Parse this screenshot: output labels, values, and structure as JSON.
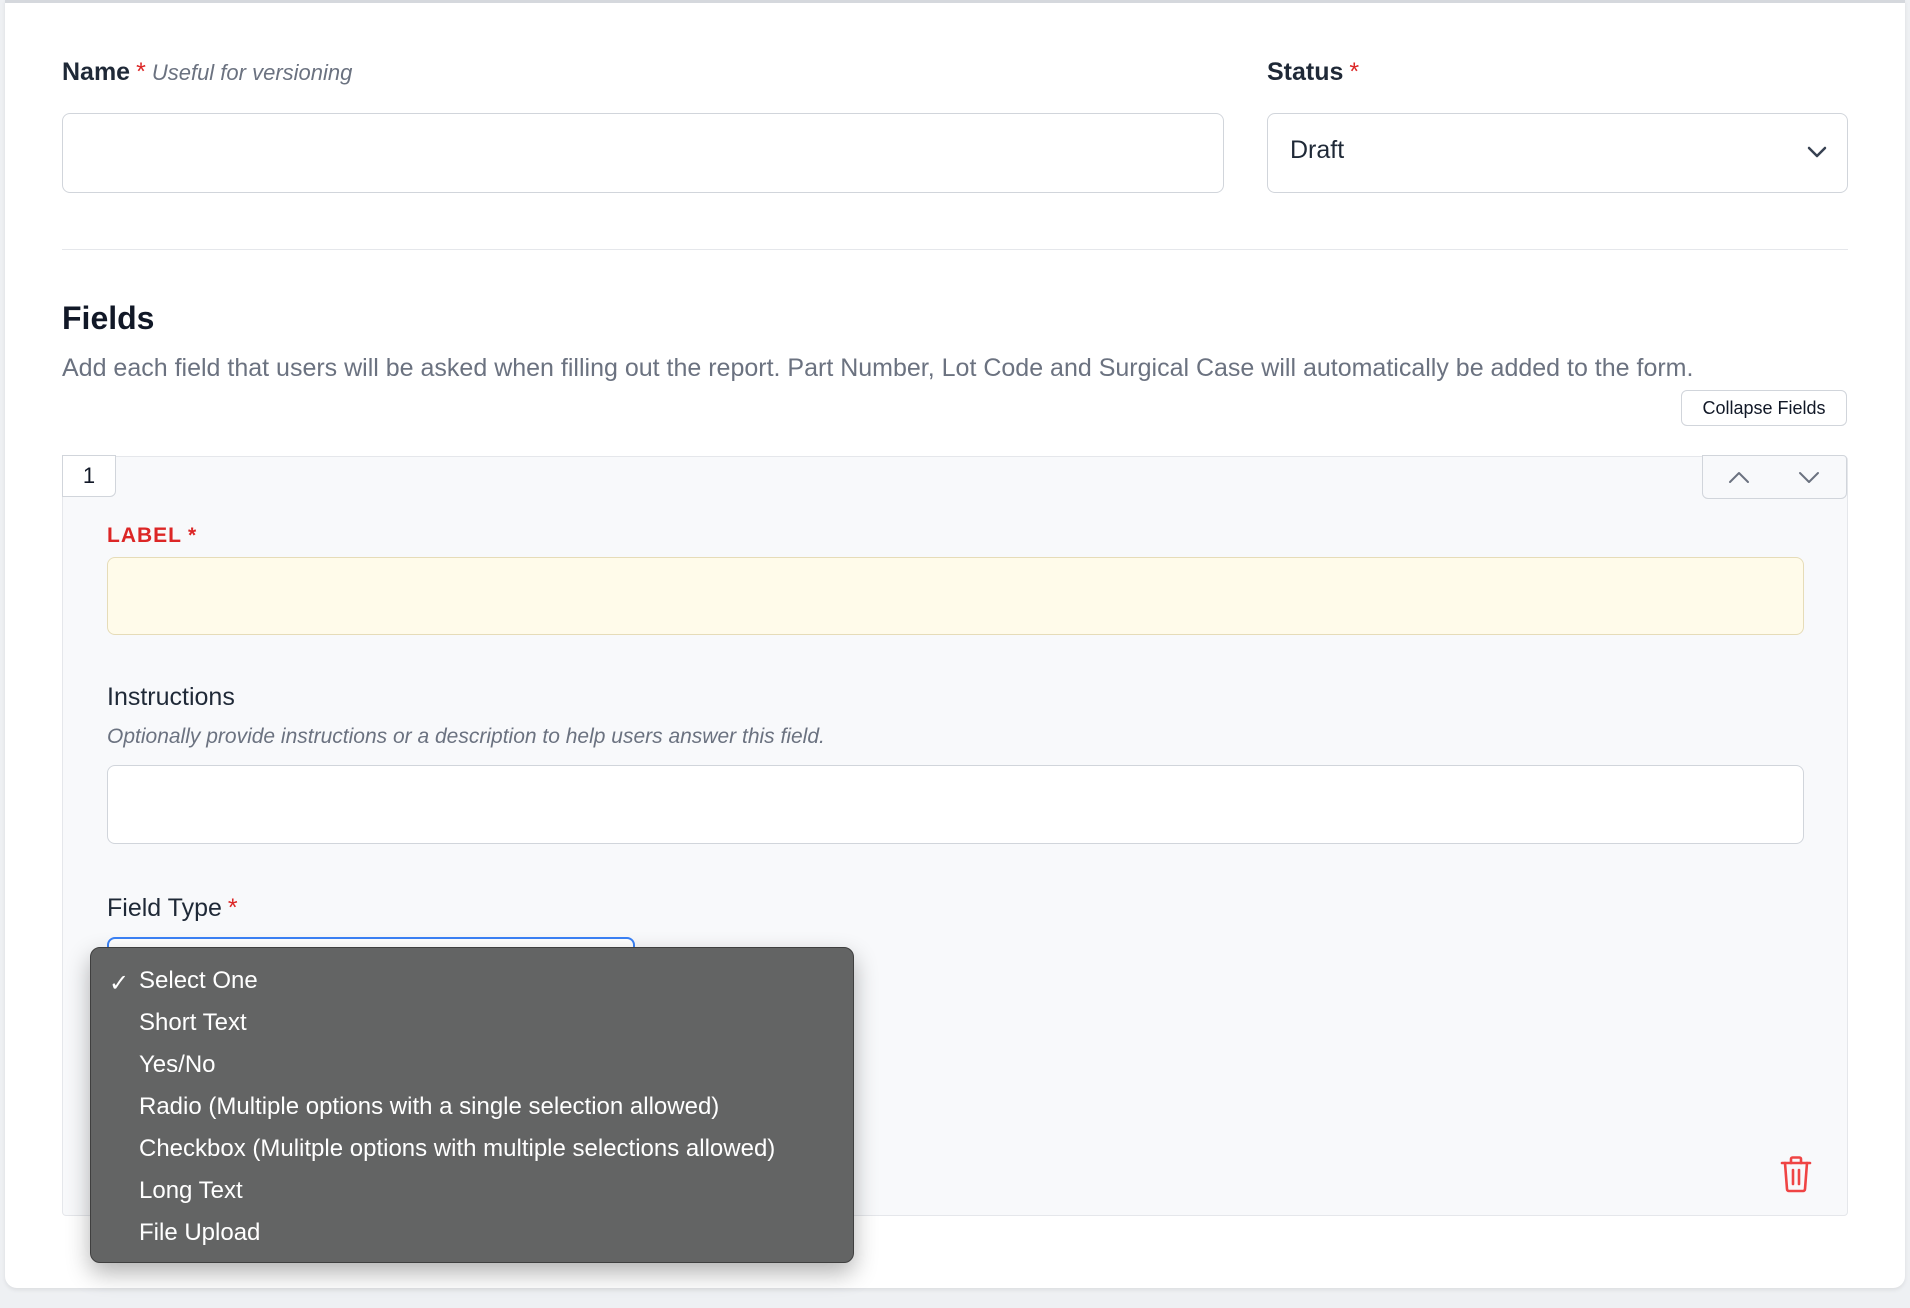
{
  "name_field": {
    "label": "Name",
    "required_mark": "*",
    "hint": "Useful for versioning",
    "value": ""
  },
  "status_field": {
    "label": "Status",
    "required_mark": "*",
    "selected": "Draft",
    "icon": "chevron-down-icon"
  },
  "fields_section": {
    "title": "Fields",
    "description": "Add each field that users will be asked when filling out the report. Part Number, Lot Code and Surgical Case will automatically be added to the form.",
    "collapse_button": "Collapse Fields"
  },
  "field_item": {
    "number": "1",
    "label_field": {
      "label": "LABEL",
      "required_mark": "*",
      "value": "",
      "highlight_color": "#fffbea"
    },
    "instructions_field": {
      "label": "Instructions",
      "hint": "Optionally provide instructions or a description to help users answer this field.",
      "value": ""
    },
    "field_type": {
      "label": "Field Type",
      "required_mark": "*",
      "options": [
        "Select One",
        "Short Text",
        "Yes/No",
        "Radio (Multiple options with a single selection allowed)",
        "Checkbox (Mulitple options with multiple selections allowed)",
        "Long Text",
        "File Upload"
      ],
      "selected_index": 0
    },
    "delete_icon": "trash-icon"
  },
  "colors": {
    "required": "#dc2626",
    "dropdown_bg": "#636464",
    "delete": "#ef4444"
  }
}
